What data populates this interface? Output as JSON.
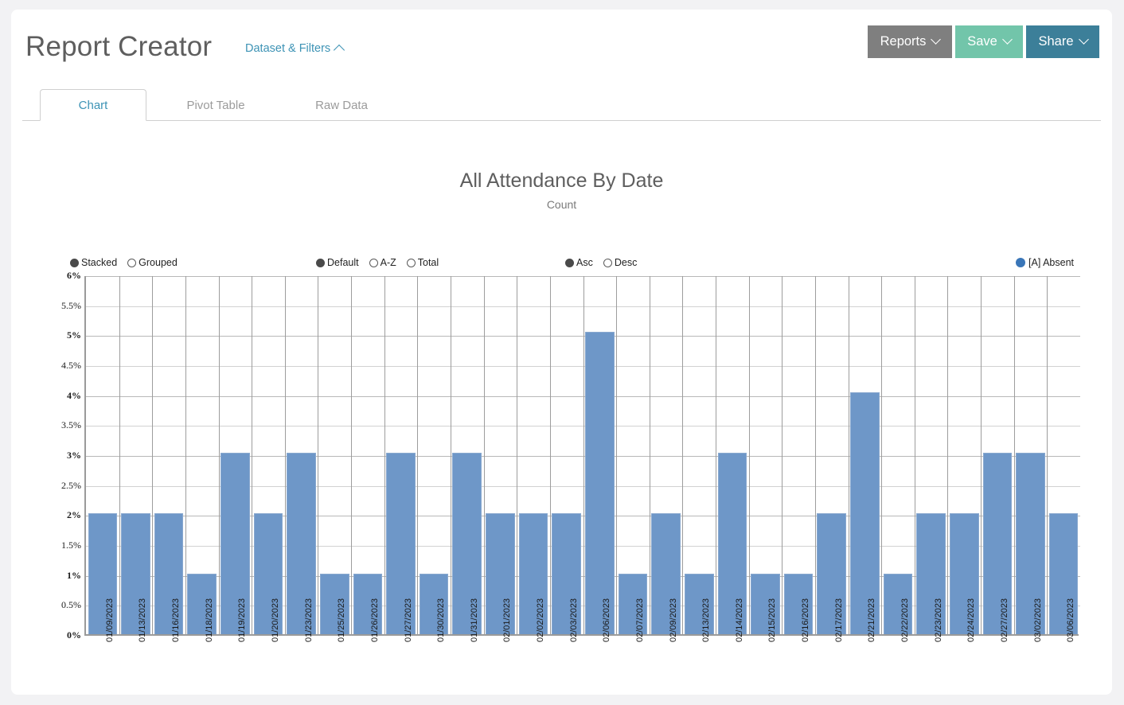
{
  "header": {
    "title": "Report Creator",
    "dataset_filters_label": "Dataset & Filters",
    "buttons": [
      {
        "label": "Reports",
        "color": "#7f7f7f"
      },
      {
        "label": "Save",
        "color": "#72c5aa"
      },
      {
        "label": "Share",
        "color": "#3c7f99"
      }
    ]
  },
  "tabs": [
    {
      "label": "Chart",
      "active": true
    },
    {
      "label": "Pivot Table",
      "active": false
    },
    {
      "label": "Raw Data",
      "active": false
    }
  ],
  "controls": {
    "stacking": [
      {
        "label": "Stacked",
        "selected": true
      },
      {
        "label": "Grouped",
        "selected": false
      }
    ],
    "sort_mode": [
      {
        "label": "Default",
        "selected": true
      },
      {
        "label": "A-Z",
        "selected": false
      },
      {
        "label": "Total",
        "selected": false
      }
    ],
    "sort_direction": [
      {
        "label": "Asc",
        "selected": true
      },
      {
        "label": "Desc",
        "selected": false
      }
    ]
  },
  "legend": {
    "entries": [
      {
        "label": "[A] Absent",
        "color": "#3a76b8"
      }
    ]
  },
  "chart_data": {
    "type": "bar",
    "title": "All Attendance By Date",
    "subtitle": "Count",
    "xlabel": "",
    "ylabel": "",
    "ylim": [
      0,
      6
    ],
    "yunit": "%",
    "ytick_labels": [
      "0%",
      "0.5%",
      "1%",
      "1.5%",
      "2%",
      "2.5%",
      "3%",
      "3.5%",
      "4%",
      "4.5%",
      "5%",
      "5.5%",
      "6%"
    ],
    "ytick_values": [
      0,
      0.5,
      1,
      1.5,
      2,
      2.5,
      3,
      3.5,
      4,
      4.5,
      5,
      5.5,
      6
    ],
    "grid": true,
    "legend_position": "top-right",
    "bar_color": "#6e97c8",
    "categories": [
      "01/09/2023",
      "01/13/2023",
      "01/16/2023",
      "01/18/2023",
      "01/19/2023",
      "01/20/2023",
      "01/23/2023",
      "01/25/2023",
      "01/26/2023",
      "01/27/2023",
      "01/30/2023",
      "01/31/2023",
      "02/01/2023",
      "02/02/2023",
      "02/03/2023",
      "02/06/2023",
      "02/07/2023",
      "02/09/2023",
      "02/13/2023",
      "02/14/2023",
      "02/15/2023",
      "02/16/2023",
      "02/17/2023",
      "02/21/2023",
      "02/22/2023",
      "02/23/2023",
      "02/24/2023",
      "02/27/2023",
      "03/02/2023",
      "03/06/2023"
    ],
    "series": [
      {
        "name": "[A] Absent",
        "color": "#6e97c8",
        "values": [
          2.02,
          2.02,
          2.02,
          1.01,
          3.03,
          2.02,
          3.03,
          1.01,
          1.01,
          3.03,
          1.01,
          3.03,
          2.02,
          2.02,
          2.02,
          5.05,
          1.01,
          2.02,
          1.01,
          3.03,
          1.01,
          1.01,
          2.02,
          4.04,
          1.01,
          2.02,
          2.02,
          3.03,
          3.03,
          2.02
        ]
      }
    ]
  }
}
